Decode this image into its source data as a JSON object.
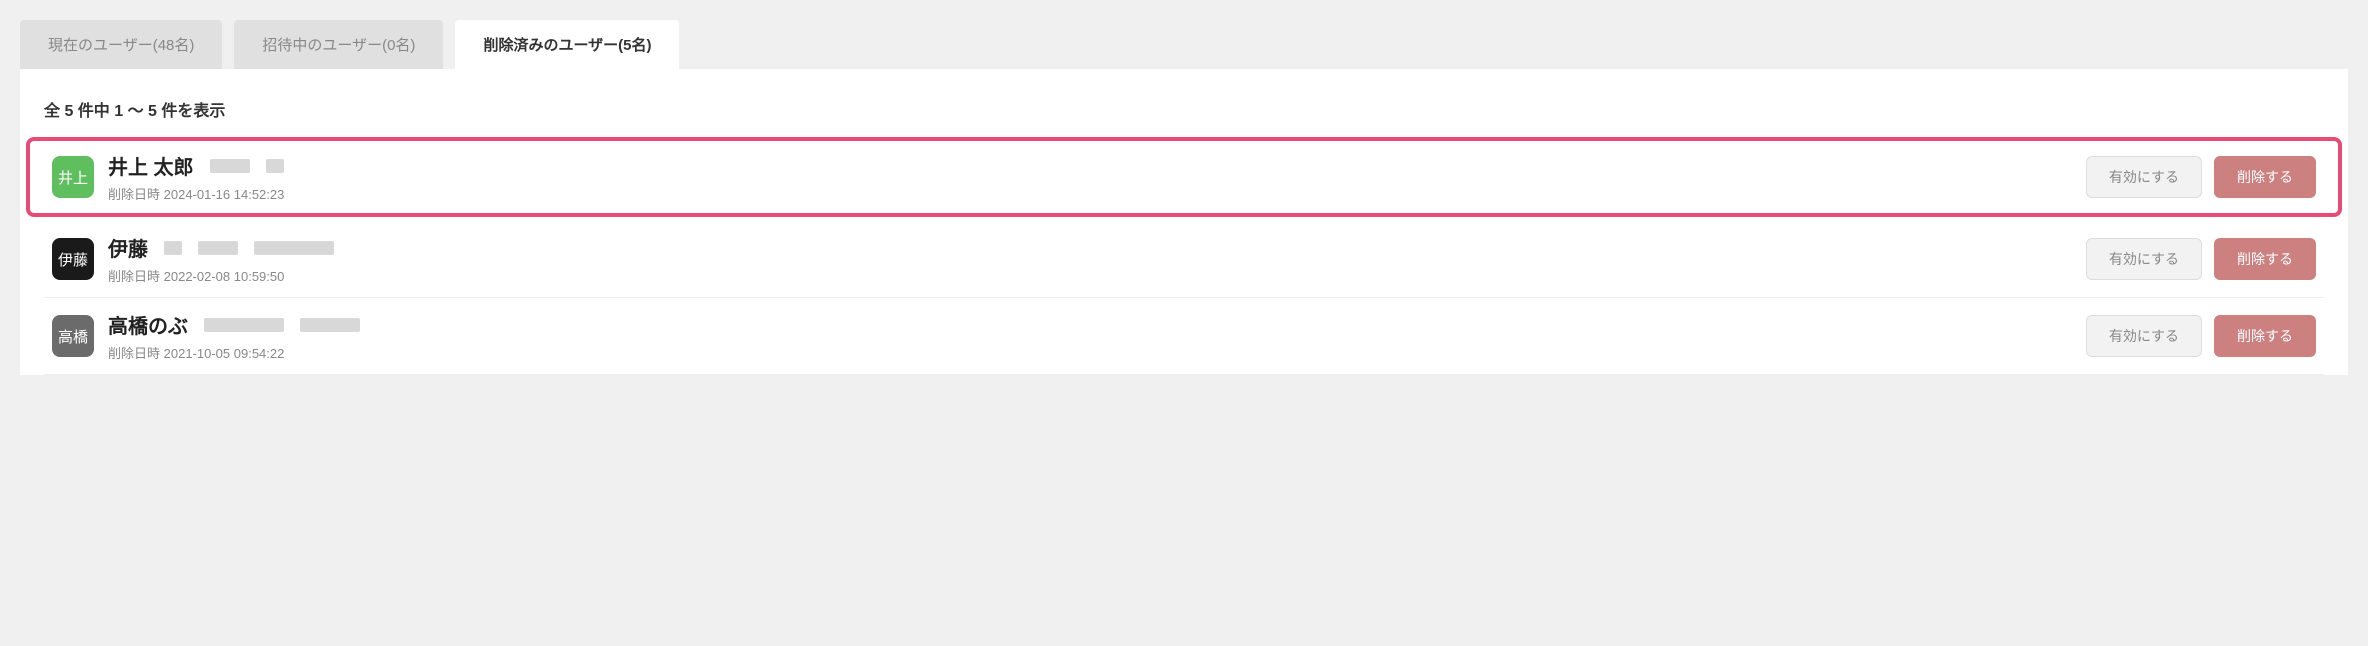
{
  "tabs": [
    {
      "label": "現在のユーザー(48名)",
      "active": false
    },
    {
      "label": "招待中のユーザー(0名)",
      "active": false
    },
    {
      "label": "削除済みのユーザー(5名)",
      "active": true
    }
  ],
  "summary": "全 5 件中 1 〜 5 件を表示",
  "deleted_at_label": "削除日時",
  "buttons": {
    "enable": "有効にする",
    "delete": "削除する"
  },
  "users": [
    {
      "name": "井上 太郎",
      "avatar_text": "井上",
      "avatar_bg": "#5fbf5f",
      "deleted_at": "2024-01-16 14:52:23",
      "highlighted": true
    },
    {
      "name": "伊藤",
      "avatar_text": "伊藤",
      "avatar_bg": "#1a1a1a",
      "deleted_at": "2022-02-08 10:59:50",
      "highlighted": false
    },
    {
      "name": "高橋のぶ",
      "avatar_text": "高橋",
      "avatar_bg": "#6b6b6b",
      "deleted_at": "2021-10-05 09:54:22",
      "highlighted": false
    }
  ]
}
